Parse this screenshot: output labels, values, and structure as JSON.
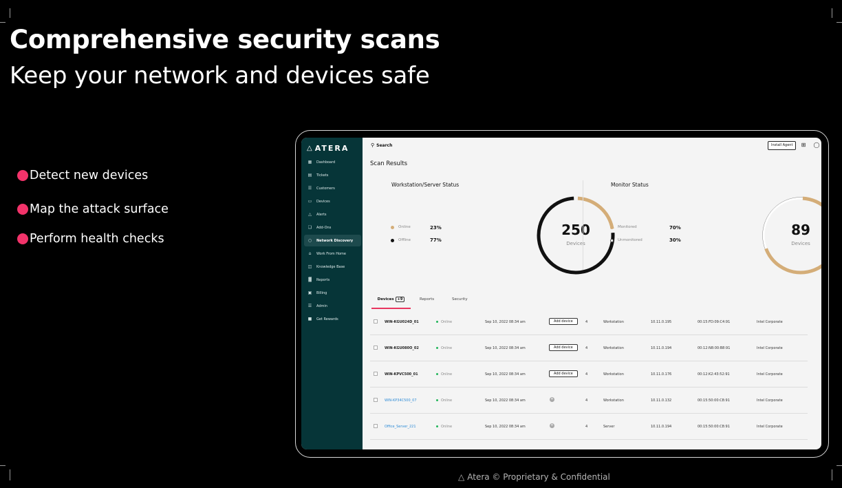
{
  "slide": {
    "headline": "Comprehensive security scans",
    "subline": "Keep your network and devices safe",
    "bullets": [
      "Detect new devices",
      "Map the attack surface",
      "Perform health checks"
    ],
    "footer": "Atera © Proprietary & Confidential",
    "accent_color": "#f2336a"
  },
  "app": {
    "brand": "ATERA",
    "brand_icon": "atera-logo-icon",
    "sidebar": {
      "bg_color": "#063538",
      "items": [
        {
          "label": "Dashboard",
          "icon": "dashboard-icon"
        },
        {
          "label": "Tickets",
          "icon": "tickets-icon"
        },
        {
          "label": "Customers",
          "icon": "customers-icon"
        },
        {
          "label": "Devices",
          "icon": "devices-icon"
        },
        {
          "label": "Alerts",
          "icon": "alert-icon"
        },
        {
          "label": "Add-Ons",
          "icon": "add-ons-icon"
        },
        {
          "label": "Network Discovery",
          "icon": "network-icon",
          "active": true
        },
        {
          "label": "Work From Home",
          "icon": "home-icon"
        },
        {
          "label": "Knowledge Base",
          "icon": "book-icon"
        },
        {
          "label": "Reports",
          "icon": "reports-icon"
        },
        {
          "label": "Billing",
          "icon": "billing-icon"
        },
        {
          "label": "Admin",
          "icon": "admin-icon"
        },
        {
          "label": "Get Rewards",
          "icon": "gift-icon"
        }
      ]
    },
    "topbar": {
      "search_label": "Search",
      "install_agent": "Install Agent",
      "icons": [
        "plus-icon",
        "lightbulb-icon",
        "chat-icon",
        "bell-icon",
        "warning-icon",
        "avatar"
      ]
    },
    "page_title": "Scan Results",
    "workstation_status": {
      "title": "Workstation/Server Status",
      "legend": [
        {
          "label": "Online",
          "value": "23%",
          "color": "#d4ad78"
        },
        {
          "label": "Offline",
          "value": "77%",
          "color": "#111111"
        }
      ],
      "total": "250",
      "total_label": "Devices",
      "online_fraction": 0.23
    },
    "monitor_status": {
      "title": "Monitor Status",
      "legend": [
        {
          "label": "Monitored",
          "value": "70%",
          "color": "#d4ad78"
        },
        {
          "label": "Unmonitored",
          "value": "30%",
          "color": "#ffffff"
        }
      ],
      "total": "89",
      "total_label": "Devices",
      "monitored_fraction": 0.7
    },
    "tabs": [
      {
        "label": "Devices",
        "count": "+9",
        "active": true
      },
      {
        "label": "Reports"
      },
      {
        "label": "Security"
      }
    ],
    "rows": [
      {
        "name": "WIN-KGU024D_01",
        "status": "Online",
        "date": "Sep 10, 2022 08:34 am",
        "action": "Add device",
        "count": "4",
        "type": "Workstation",
        "ip": "10.11.0.195",
        "mac": "00:15:FD:09:C4:91",
        "vendor": "Intel Corporate",
        "link": false
      },
      {
        "name": "WIN-KGU080O_02",
        "status": "Online",
        "date": "Sep 10, 2022 08:34 am",
        "action": "Add device",
        "count": "4",
        "type": "Workstation",
        "ip": "10.11.0.194",
        "mac": "00:12:N8:00:B8:91",
        "vendor": "Intel Corporate",
        "link": false
      },
      {
        "name": "WIN-KPVC500_01",
        "status": "Online",
        "date": "Sep 10, 2022 08:34 am",
        "action": "Add device",
        "count": "4",
        "type": "Workstation",
        "ip": "10.11.0.176",
        "mac": "00:12:K2:43:52:91",
        "vendor": "Intel Corporate",
        "link": false
      },
      {
        "name": "WIN-KP34C500_07",
        "status": "Online",
        "date": "Sep 10, 2022 08:34 am",
        "action": "",
        "count": "4",
        "type": "Workstation",
        "ip": "10.11.0.132",
        "mac": "00:15:50:00:C8:91",
        "vendor": "Intel Corporate",
        "link": true
      },
      {
        "name": "Office_Server_221",
        "status": "Online",
        "date": "Sep 10, 2022 08:34 am",
        "action": "",
        "count": "4",
        "type": "Server",
        "ip": "10.11.0.194",
        "mac": "00:15:50:00:C8:91",
        "vendor": "Intel Corporate",
        "link": true
      }
    ]
  }
}
